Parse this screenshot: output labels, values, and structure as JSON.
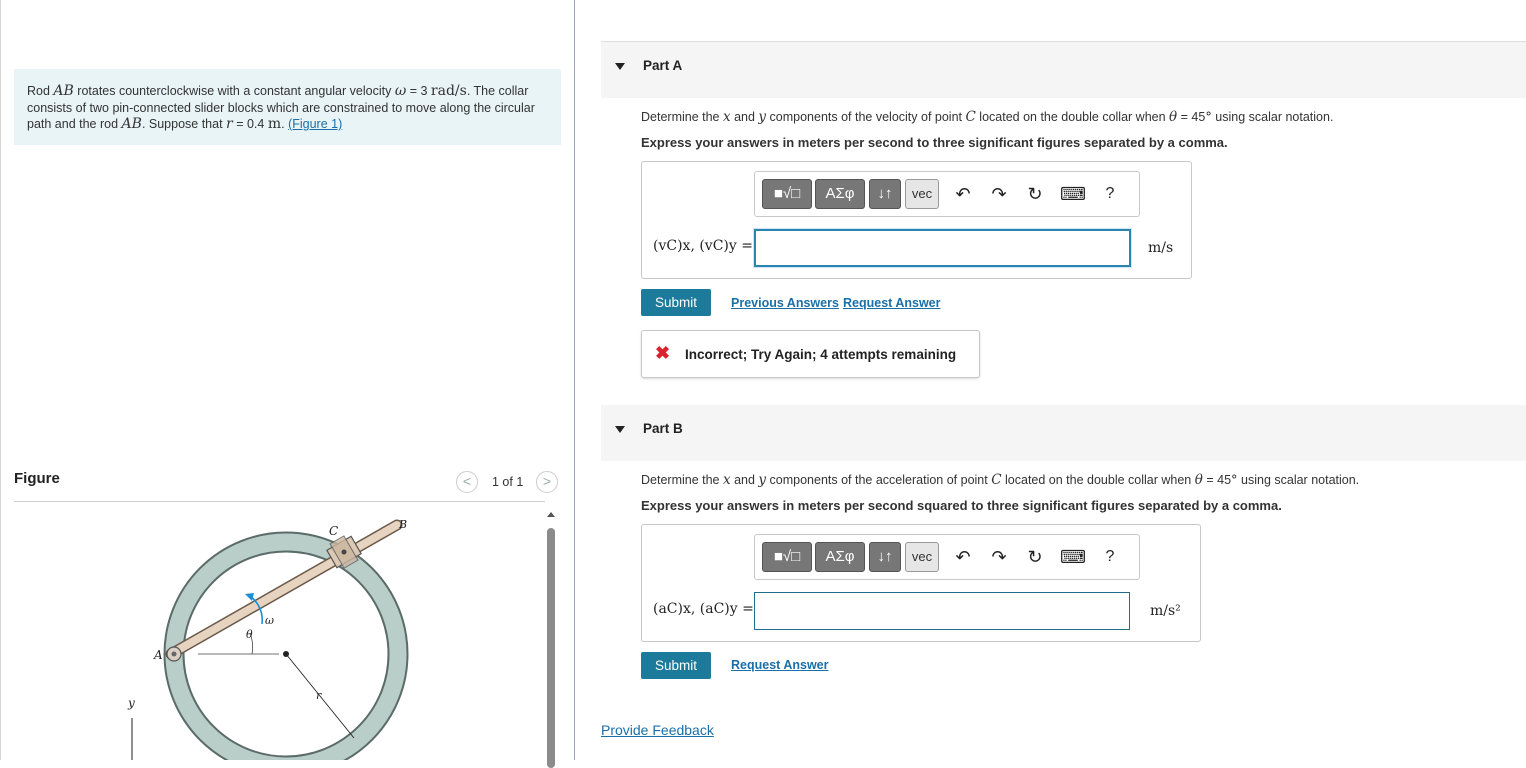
{
  "problem": {
    "t1": "Rod ",
    "m1": "AB",
    "t2": " rotates counterclockwise with a constant angular velocity ",
    "m2": "ω",
    "t3": " = 3 ",
    "u1": "rad/s",
    "t4": ". The collar consists of two pin-connected slider blocks which are constrained to move along the circular path and the rod ",
    "m3": "AB",
    "t5": ". Suppose that ",
    "m4": "r",
    "t6": " = 0.4 ",
    "u2": "m",
    "t7": ". ",
    "figure_link": "(Figure 1)"
  },
  "figure": {
    "title": "Figure",
    "page_count": "1 of 1",
    "prev_icon": "<",
    "next_icon": ">",
    "labels": {
      "A": "A",
      "B": "B",
      "C": "C",
      "omega": "ω",
      "theta": "θ",
      "r": "r",
      "y": "y"
    }
  },
  "part_a": {
    "label": "Part A",
    "q1": "Determine the ",
    "qx": "x",
    "q2": " and ",
    "qy": "y",
    "q3": " components of the velocity of point ",
    "qc": "C",
    "q4": " located on the double collar when ",
    "qt": "θ",
    "q5": " = 45",
    "q6": "°",
    "q7": " using scalar notation.",
    "instruction": "Express your answers in meters per second to three significant figures separated by a comma.",
    "answer_label": "(vC)x, (vC)y =",
    "answer_value": "",
    "unit": "m/s",
    "submit": "Submit",
    "previous_answers": "Previous Answers",
    "request_answer": "Request Answer",
    "feedback": "Incorrect; Try Again; 4 attempts remaining",
    "feedback_icon": "✖"
  },
  "part_b": {
    "label": "Part B",
    "q1": "Determine the ",
    "qx": "x",
    "q2": " and ",
    "qy": "y",
    "q3": " components of the acceleration of point ",
    "qc": "C",
    "q4": " located on the double collar when ",
    "qt": "θ",
    "q5": " = 45",
    "q6": "°",
    "q7": " using scalar notation.",
    "instruction": "Express your answers in meters per second squared to three significant figures separated by a comma.",
    "answer_label": "(aC)x, (aC)y =",
    "answer_value": "",
    "unit": "m/s²",
    "submit": "Submit",
    "request_answer": "Request Answer"
  },
  "toolbar": {
    "templates": "■√□",
    "greek": "ΑΣφ",
    "arrows": "↓↑",
    "vec": "vec",
    "undo": "↶",
    "redo": "↷",
    "reset": "↻",
    "keyboard": "⌨",
    "help": "?"
  },
  "provide_feedback": "Provide Feedback"
}
